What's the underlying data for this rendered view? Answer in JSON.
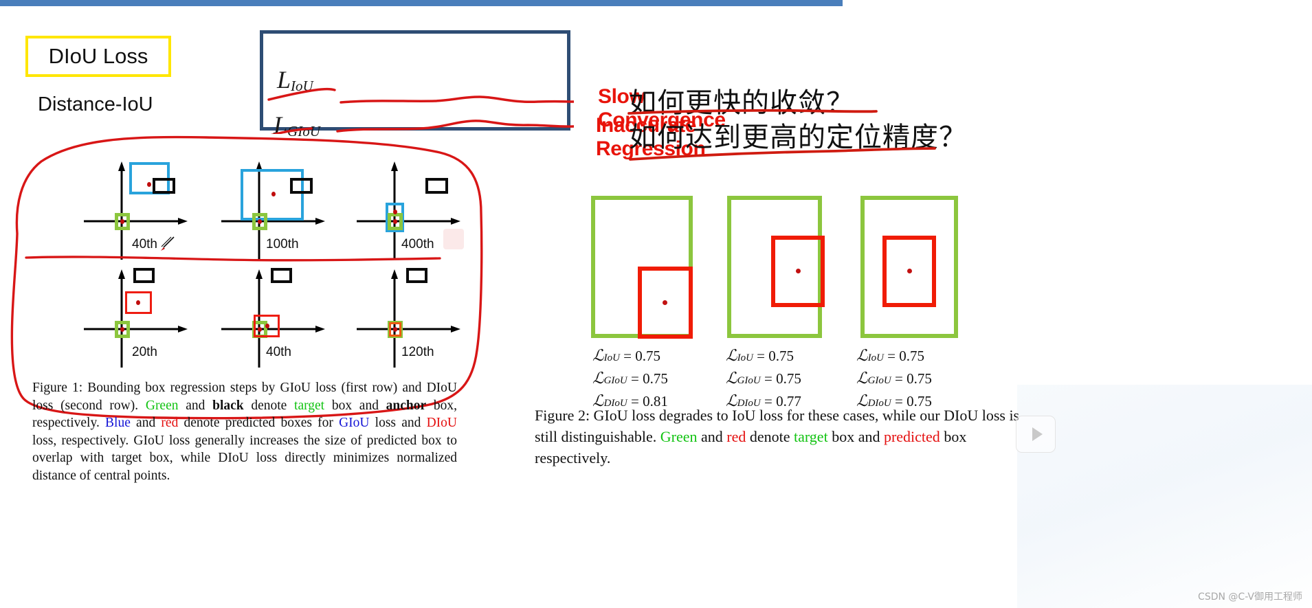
{
  "slide": {
    "title": "DIoU Loss",
    "subtitle": "Distance-IoU"
  },
  "loss_callout": {
    "math_labels": [
      {
        "base": "L",
        "sub": "IoU"
      },
      {
        "base": "L",
        "sub": "GIoU"
      }
    ],
    "red_lines": [
      "Slow Convergence",
      "Inaccurate Regression"
    ],
    "border_color": "#2e4d74",
    "text_color": "#e8140b"
  },
  "questions": {
    "line1": "如何更快的收敛？",
    "line2": "如何达到更高的定位精度？"
  },
  "figure1": {
    "rows": [
      {
        "name": "GIoU",
        "steps": [
          "40th",
          "100th",
          "400th"
        ]
      },
      {
        "name": "DIoU",
        "steps": [
          "20th",
          "40th",
          "120th"
        ]
      }
    ],
    "caption": {
      "label": "Figure 1:",
      "text_parts": [
        {
          "t": "Figure 1: Bounding box regression steps by GIoU loss (first row) and DIoU loss (second row). ",
          "style": "normal"
        },
        {
          "t": "Green",
          "style": "green"
        },
        {
          "t": " and ",
          "style": "normal"
        },
        {
          "t": "black",
          "style": "bold"
        },
        {
          "t": " denote ",
          "style": "normal"
        },
        {
          "t": "target",
          "style": "green"
        },
        {
          "t": " box and ",
          "style": "normal"
        },
        {
          "t": "anchor",
          "style": "bold"
        },
        {
          "t": " box, respectively. ",
          "style": "normal"
        },
        {
          "t": "Blue",
          "style": "blue"
        },
        {
          "t": " and ",
          "style": "normal"
        },
        {
          "t": "red",
          "style": "red"
        },
        {
          "t": " denote predicted boxes for ",
          "style": "normal"
        },
        {
          "t": "GIoU",
          "style": "blue"
        },
        {
          "t": " loss and ",
          "style": "normal"
        },
        {
          "t": "DIoU",
          "style": "red"
        },
        {
          "t": " loss, respectively. GIoU loss generally increases the size of predicted box to overlap with target box, while DIoU loss directly minimizes normalized distance of central points.",
          "style": "normal"
        }
      ]
    }
  },
  "figure2": {
    "cases": [
      {
        "losses": [
          {
            "name": "IoU",
            "value": "0.75"
          },
          {
            "name": "GIoU",
            "value": "0.75"
          },
          {
            "name": "DIoU",
            "value": "0.81"
          }
        ]
      },
      {
        "losses": [
          {
            "name": "IoU",
            "value": "0.75"
          },
          {
            "name": "GIoU",
            "value": "0.75"
          },
          {
            "name": "DIoU",
            "value": "0.77"
          }
        ]
      },
      {
        "losses": [
          {
            "name": "IoU",
            "value": "0.75"
          },
          {
            "name": "GIoU",
            "value": "0.75"
          },
          {
            "name": "DIoU",
            "value": "0.75"
          }
        ]
      }
    ],
    "caption_parts": [
      {
        "t": "Figure 2: GIoU loss degrades to IoU loss for these cases, while our DIoU loss is still distinguishable. ",
        "style": "normal"
      },
      {
        "t": "Green",
        "style": "green"
      },
      {
        "t": " and ",
        "style": "normal"
      },
      {
        "t": "red",
        "style": "red"
      },
      {
        "t": " denote ",
        "style": "normal"
      },
      {
        "t": "target",
        "style": "green"
      },
      {
        "t": " box and ",
        "style": "normal"
      },
      {
        "t": "predicted",
        "style": "red"
      },
      {
        "t": " box respectively.",
        "style": "normal"
      }
    ]
  },
  "watermark": "CSDN @C-V御用工程师",
  "colors": {
    "top_bar": "#4a7ebb",
    "title_border": "#ffe600",
    "green_box": "#8cc63e",
    "red_box": "#ee1c11",
    "blue_box": "#29a3dc",
    "black_box": "#0b0b0b",
    "annotation_red": "#d81616"
  }
}
